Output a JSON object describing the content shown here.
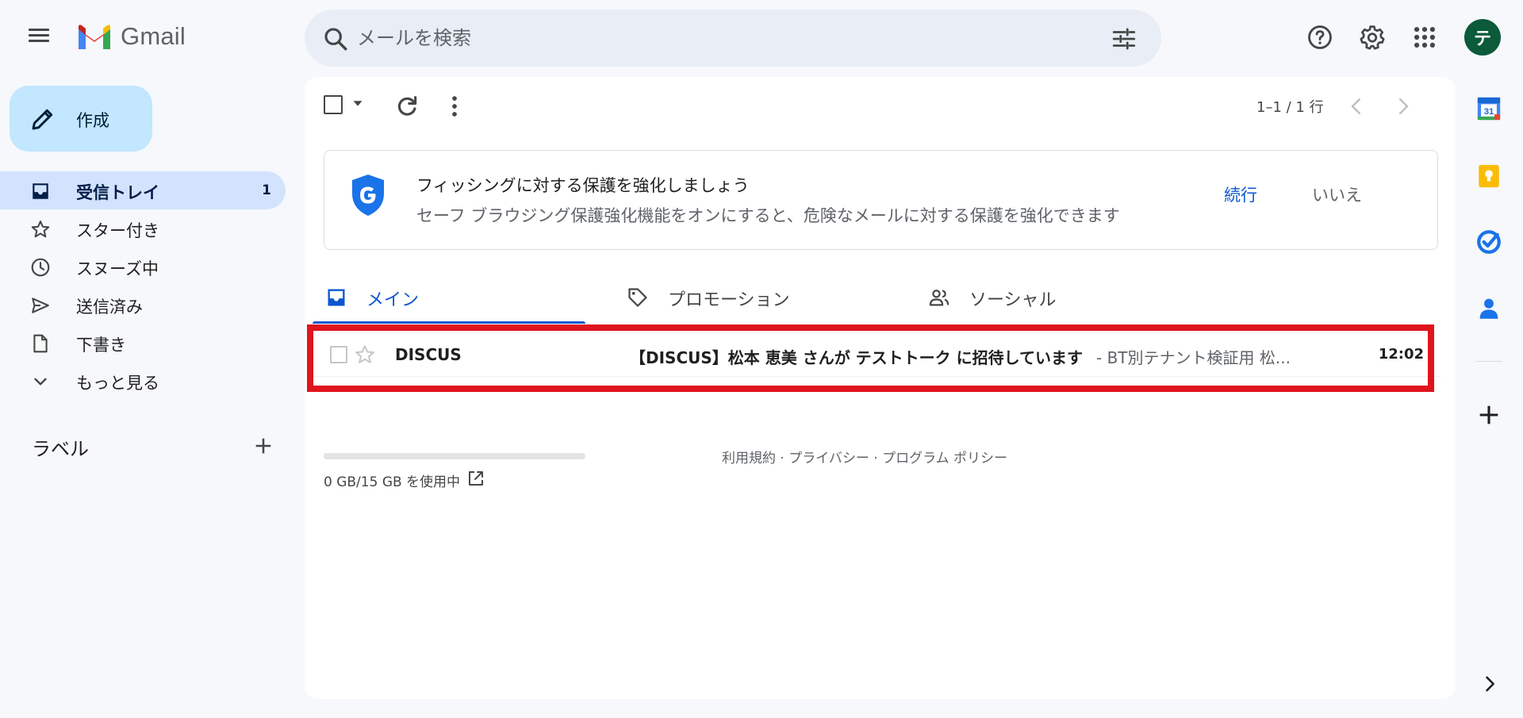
{
  "app": {
    "name": "Gmail"
  },
  "search": {
    "placeholder": "メールを検索"
  },
  "account": {
    "initial": "テ"
  },
  "compose": {
    "label": "作成"
  },
  "nav": {
    "inbox": {
      "label": "受信トレイ",
      "count": "1"
    },
    "starred": {
      "label": "スター付き"
    },
    "snoozed": {
      "label": "スヌーズ中"
    },
    "sent": {
      "label": "送信済み"
    },
    "drafts": {
      "label": "下書き"
    },
    "more": {
      "label": "もっと見る"
    }
  },
  "labels": {
    "heading": "ラベル"
  },
  "toolbar": {
    "pagination": "1–1 / 1 行"
  },
  "banner": {
    "title": "フィッシングに対する保護を強化しましょう",
    "text": "セーフ ブラウジング保護強化機能をオンにすると、危険なメールに対する保護を強化できます",
    "continue_label": "続行",
    "dismiss_label": "いいえ"
  },
  "tabs": {
    "primary": "メイン",
    "promotions": "プロモーション",
    "social": "ソーシャル"
  },
  "emails": [
    {
      "sender": "DISCUS",
      "subject": "【DISCUS】松本 恵美 さんが テストトーク に招待しています",
      "snippet": " - BT別テナント検証用 松...",
      "time": "12:02"
    }
  ],
  "storage": {
    "usage": "0 GB/15 GB を使用中",
    "fraction_used": 0.0
  },
  "footer": {
    "terms": "利用規約",
    "sep": " · ",
    "privacy": "プライバシー",
    "policy": "プログラム ポリシー"
  },
  "colors": {
    "accent": "#0b57d0",
    "highlight": "#e0141d",
    "avatar": "#0b5a3a"
  }
}
